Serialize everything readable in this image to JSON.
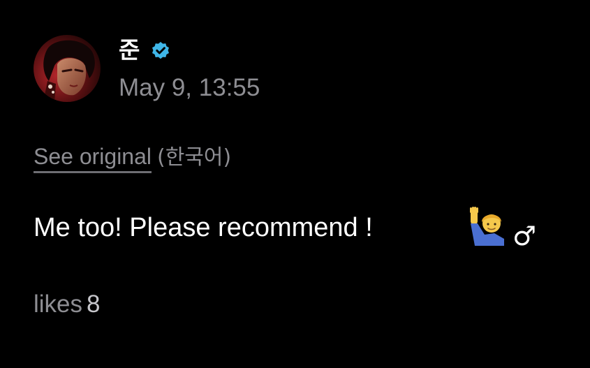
{
  "post": {
    "author": {
      "name": "준",
      "verified": true,
      "avatar_icon": "profile-photo"
    },
    "timestamp": "May 9, 13:55",
    "translation": {
      "see_original_label": "See original",
      "language_label": "(한국어)"
    },
    "text": "Me too! Please recommend !",
    "emojis": {
      "person": "person-raising-hand-emoji",
      "male_sign": "♂"
    },
    "likes": {
      "label": "likes",
      "count": "8"
    }
  },
  "colors": {
    "background": "#000000",
    "primary_text": "#ffffff",
    "secondary_text": "#8e8e93",
    "verified_badge": "#3fb6e8"
  }
}
